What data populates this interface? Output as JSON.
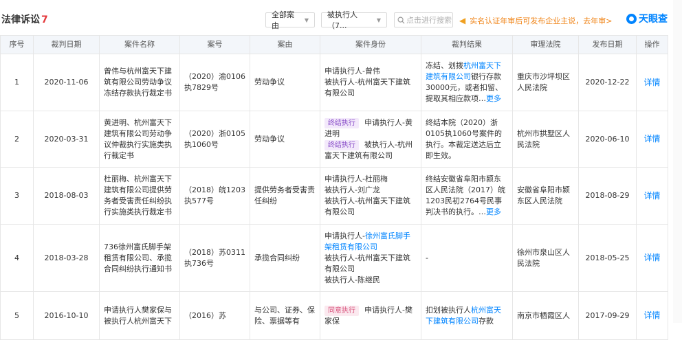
{
  "header": {
    "title": "法律诉讼",
    "count": "7",
    "filter_cause": "全部案由",
    "filter_identity": "被执行人（7...",
    "search_placeholder": "点击进行搜索",
    "notice": "实名认证年审后可发布企业主说，去年审>",
    "logo": "天眼查"
  },
  "table": {
    "columns": [
      "序号",
      "裁判日期",
      "案件名称",
      "案号",
      "案由",
      "案件身份",
      "裁判结果",
      "审理法院",
      "发布日期",
      "操作"
    ],
    "rows": [
      {
        "no": "1",
        "date": "2020-11-06",
        "name": "曾伟与杭州富天下建筑有限公司劳动争议冻结存款执行裁定书",
        "case_no": "（2020）渝0106执7829号",
        "cause": "劳动争议",
        "identity_1": "申请执行人-曾伟",
        "identity_2": "被执行人-杭州富天下建筑有限公司",
        "result_pre": "冻结、划拨",
        "result_link": "杭州富天下建筑有限公司",
        "result_post": "银行存款30000元，或者扣留、提取其相应款项",
        "more": "更多",
        "court": "重庆市沙坪坝区人民法院",
        "pub": "2020-12-22",
        "op": "详情"
      },
      {
        "no": "2",
        "date": "2020-03-31",
        "name": "黄进明、杭州富天下建筑有限公司劳动争议仲裁执行实施类执行裁定书",
        "case_no": "（2020）浙0105执1060号",
        "cause": "劳动争议",
        "tag_1": "终结执行",
        "identity_1": "申请执行人-黄进明",
        "tag_2": "终结执行",
        "identity_2": "被执行人-杭州富天下建筑有限公司",
        "result": "终结本院（2020）浙0105执1060号案件的执行。本裁定送达后立即生效。",
        "court": "杭州市拱墅区人民法院",
        "pub": "2020-06-10",
        "op": "详情"
      },
      {
        "no": "3",
        "date": "2018-08-03",
        "name": "杜丽梅、杭州富天下建筑有限公司提供劳务者受害责任纠纷执行实施类执行裁定书",
        "case_no": "（2018）皖1203执577号",
        "cause": "提供劳务者受害责任纠纷",
        "identity_1": "申请执行人-杜丽梅",
        "identity_2": "被执行人-刘广龙",
        "identity_3": "被执行人-杭州富天下建筑有限公司",
        "result": "终结安徽省阜阳市颍东区人民法院（2017）皖1203民初2764号民事判决书的执行。",
        "more": "更多",
        "court": "安徽省阜阳市颍东区人民法院",
        "pub": "2018-08-29",
        "op": "详情"
      },
      {
        "no": "4",
        "date": "2018-03-28",
        "name": "736徐州富氏脚手架租赁有限公司、承揽合同纠纷执行通知书",
        "case_no": "（2018）苏0311执736号",
        "cause": "承揽合同纠纷",
        "identity_1_pre": "申请执行人-",
        "identity_1_link": "徐州富氏脚手架租赁有限公司",
        "identity_2": "被执行人-杭州富天下建筑有限公司",
        "identity_3": "被执行人-陈继民",
        "result": "-",
        "court": "徐州市泉山区人民法院",
        "pub": "2018-05-25",
        "op": "详情"
      },
      {
        "no": "5",
        "date": "2016-10-10",
        "name": "申请执行人樊家保与被执行人杭州富天下",
        "case_no": "（2016）苏",
        "cause": "与公司、证券、保险、票据等有",
        "tag_1": "同意执行",
        "identity_1": "申请执行人-樊家保",
        "result_pre": "扣划被执行人",
        "result_link": "杭州富天下建筑有限公司",
        "result_post": "存款",
        "court": "南京市栖霞区人",
        "pub": "2017-09-29",
        "op": "详情"
      }
    ]
  },
  "colors": {
    "accent": "#0084ff",
    "count": "#e4393c",
    "notice": "#f08519"
  }
}
